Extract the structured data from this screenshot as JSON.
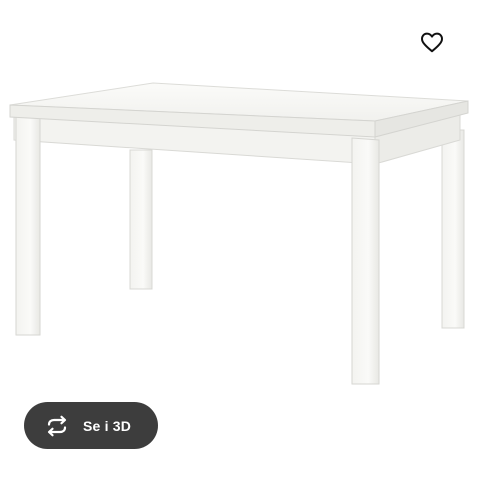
{
  "product": {
    "image_alt": "",
    "table_color": "#ffffff"
  },
  "favorite": {
    "icon": "heart-outline-icon"
  },
  "view_3d": {
    "label": "Se i 3D",
    "icon": "rotate-arrows-icon",
    "background": "#3d3d3d",
    "text_color": "#ffffff"
  }
}
